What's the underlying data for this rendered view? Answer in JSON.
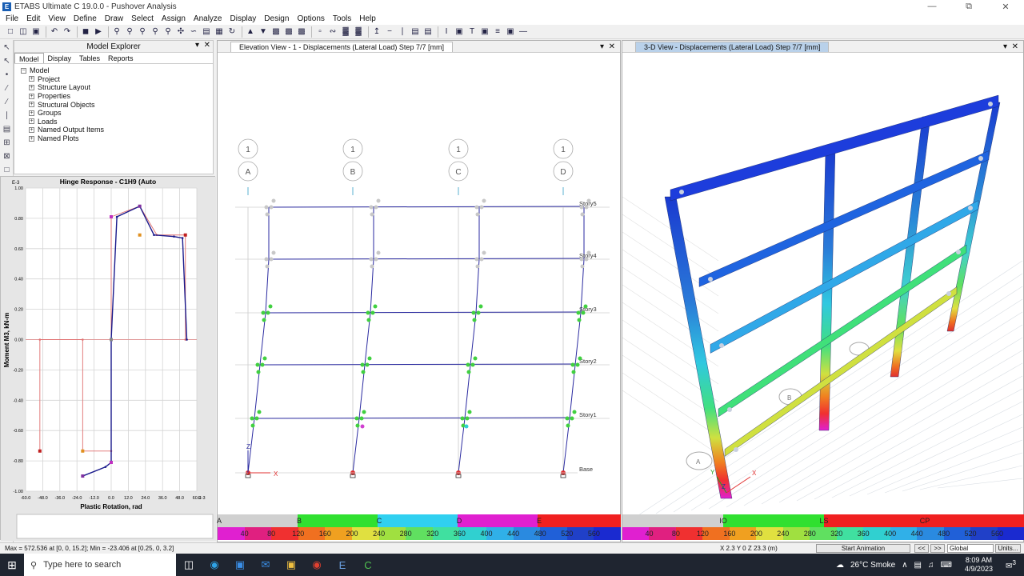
{
  "window": {
    "title": "ETABS Ultimate C 19.0.0 - Pushover Analysis",
    "app_icon": "E"
  },
  "menu": [
    "File",
    "Edit",
    "View",
    "Define",
    "Draw",
    "Select",
    "Assign",
    "Analyze",
    "Display",
    "Design",
    "Options",
    "Tools",
    "Help"
  ],
  "explorer": {
    "title": "Model Explorer",
    "tabs": [
      "Model",
      "Display",
      "Tables",
      "Reports"
    ],
    "root": "Model",
    "items": [
      "Project",
      "Structure Layout",
      "Properties",
      "Structural Objects",
      "Groups",
      "Loads",
      "Named Output Items",
      "Named Plots"
    ]
  },
  "hinge": {
    "title": "Hinge Response - C1H9 (Auto",
    "exponent": "E-3",
    "x_exponent": "E-3",
    "ylabel": "Moment M3, kN-m",
    "xlabel": "Plastic Rotation, rad",
    "y_ticks": [
      "1.00",
      "0.80",
      "0.60",
      "0.40",
      "0.20",
      "0.00",
      "-0.20",
      "-0.40",
      "-0.60",
      "-0.80",
      "-1.00"
    ],
    "x_ticks": [
      "-60.0",
      "-48.0",
      "-36.0",
      "-24.0",
      "-12.0",
      "0.0",
      "12.0",
      "24.0",
      "36.0",
      "48.0",
      "60.0"
    ]
  },
  "chart_data": {
    "type": "line",
    "title": "Hinge Response - C1H9 (Auto",
    "xlabel": "Plastic Rotation, rad",
    "ylabel": "Moment M3, kN-m",
    "xlim": [
      -60,
      60
    ],
    "ylim": [
      -1.0,
      1.0
    ],
    "grid": true,
    "series": [
      {
        "x": [
          -50,
          -50,
          -20,
          -20,
          0,
          0,
          0,
          20,
          32,
          52,
          52
        ],
        "y": [
          -0.735,
          0.0,
          0.0,
          -0.735,
          -0.735,
          0.0,
          0.81,
          0.88,
          0.69,
          0.69,
          0.0
        ]
      },
      {
        "x": [
          -20,
          -4,
          0,
          0,
          4,
          20,
          30,
          44,
          50,
          53
        ],
        "y": [
          -0.9,
          -0.84,
          -0.81,
          0.0,
          0.81,
          0.88,
          0.69,
          0.68,
          0.67,
          0.0
        ]
      }
    ]
  },
  "elevation_view": {
    "tab": "Elevation View - 1  - Displacements (Lateral Load)  Step 7/7  [mm]",
    "grid_numbers": [
      "1",
      "1",
      "1",
      "1"
    ],
    "grid_letters": [
      "A",
      "B",
      "C",
      "D"
    ],
    "stories": [
      "Story5",
      "Story4",
      "Story3",
      "Story2",
      "Story1",
      "Base"
    ],
    "axis_z": "Z",
    "axis_x": "X"
  },
  "view3d": {
    "tab": "3-D View  - Displacements (Lateral Load)  Step 7/7  [mm]",
    "axis_x": "X",
    "axis_y": "Y",
    "axis_z": "Z",
    "grid_a": "A",
    "grid_b": "B"
  },
  "legend_left": {
    "states": [
      "A",
      "B",
      "C",
      "D",
      "E"
    ],
    "values": [
      "40",
      "80",
      "120",
      "160",
      "200",
      "240",
      "280",
      "320",
      "360",
      "400",
      "440",
      "480",
      "520",
      "560"
    ]
  },
  "legend_right": {
    "states": [
      "IO",
      "LS",
      "CP"
    ],
    "values": [
      "40",
      "80",
      "120",
      "160",
      "200",
      "240",
      "280",
      "320",
      "360",
      "400",
      "440",
      "480",
      "520",
      "560"
    ]
  },
  "status": {
    "left": "Max = 572.536 at [0, 0, 15.2];  Min = -23.406 at [0.25, 0, 3.2]",
    "coords": "X 2.3  Y 0  Z 23.3 (m)",
    "animate": "Start Animation",
    "nav_prev": "<<",
    "nav_next": ">>",
    "coordsys": "Global",
    "units": "Units..."
  },
  "taskbar": {
    "search": "Type here to search",
    "weather": "26°C  Smoke",
    "time": "8:09 AM",
    "date": "4/9/2023",
    "notifications": "3"
  }
}
